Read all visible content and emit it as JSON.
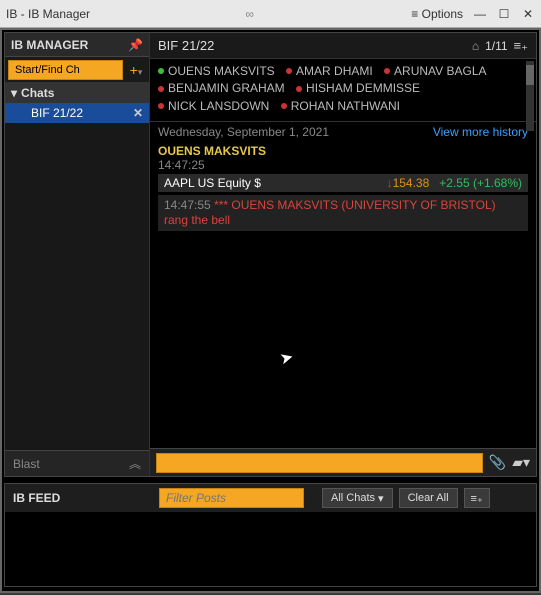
{
  "titlebar": {
    "title": "IB - IB Manager",
    "center": "∞",
    "options": "≡ Options"
  },
  "sidebar": {
    "header": "IB MANAGER",
    "start_find": "Start/Find Ch",
    "plus": "+",
    "tree_header": "Chats",
    "active_chat": "BIF 21/22",
    "blast": "Blast"
  },
  "chat": {
    "title": "BIF 21/22",
    "counter": "1/11",
    "participants": [
      {
        "name": "OUENS MAKSVITS",
        "status": "green"
      },
      {
        "name": "AMAR DHAMI",
        "status": "red"
      },
      {
        "name": "ARUNAV BAGLA",
        "status": "red"
      },
      {
        "name": "BENJAMIN GRAHAM",
        "status": "red"
      },
      {
        "name": "HISHAM DEMMISSE",
        "status": "red"
      },
      {
        "name": "NICK LANSDOWN",
        "status": "red"
      },
      {
        "name": "ROHAN NATHWANI",
        "status": "red"
      }
    ],
    "date": "Wednesday, September 1, 2021",
    "history_link": "View more history",
    "sender": "OUENS MAKSVITS",
    "msg_time": "14:47:25",
    "ticker": {
      "symbol": "AAPL  US Equity $",
      "arrow": "↓",
      "price": "154.38",
      "change": "+2.55 (+1.68%)"
    },
    "bell": {
      "time": "14:47:55",
      "text": "*** OUENS MAKSVITS (UNIVERSITY OF BRISTOL) rang the bell"
    }
  },
  "feed": {
    "title": "IB FEED",
    "filter_placeholder": "Filter Posts",
    "all_chats": "All Chats",
    "clear": "Clear All"
  }
}
